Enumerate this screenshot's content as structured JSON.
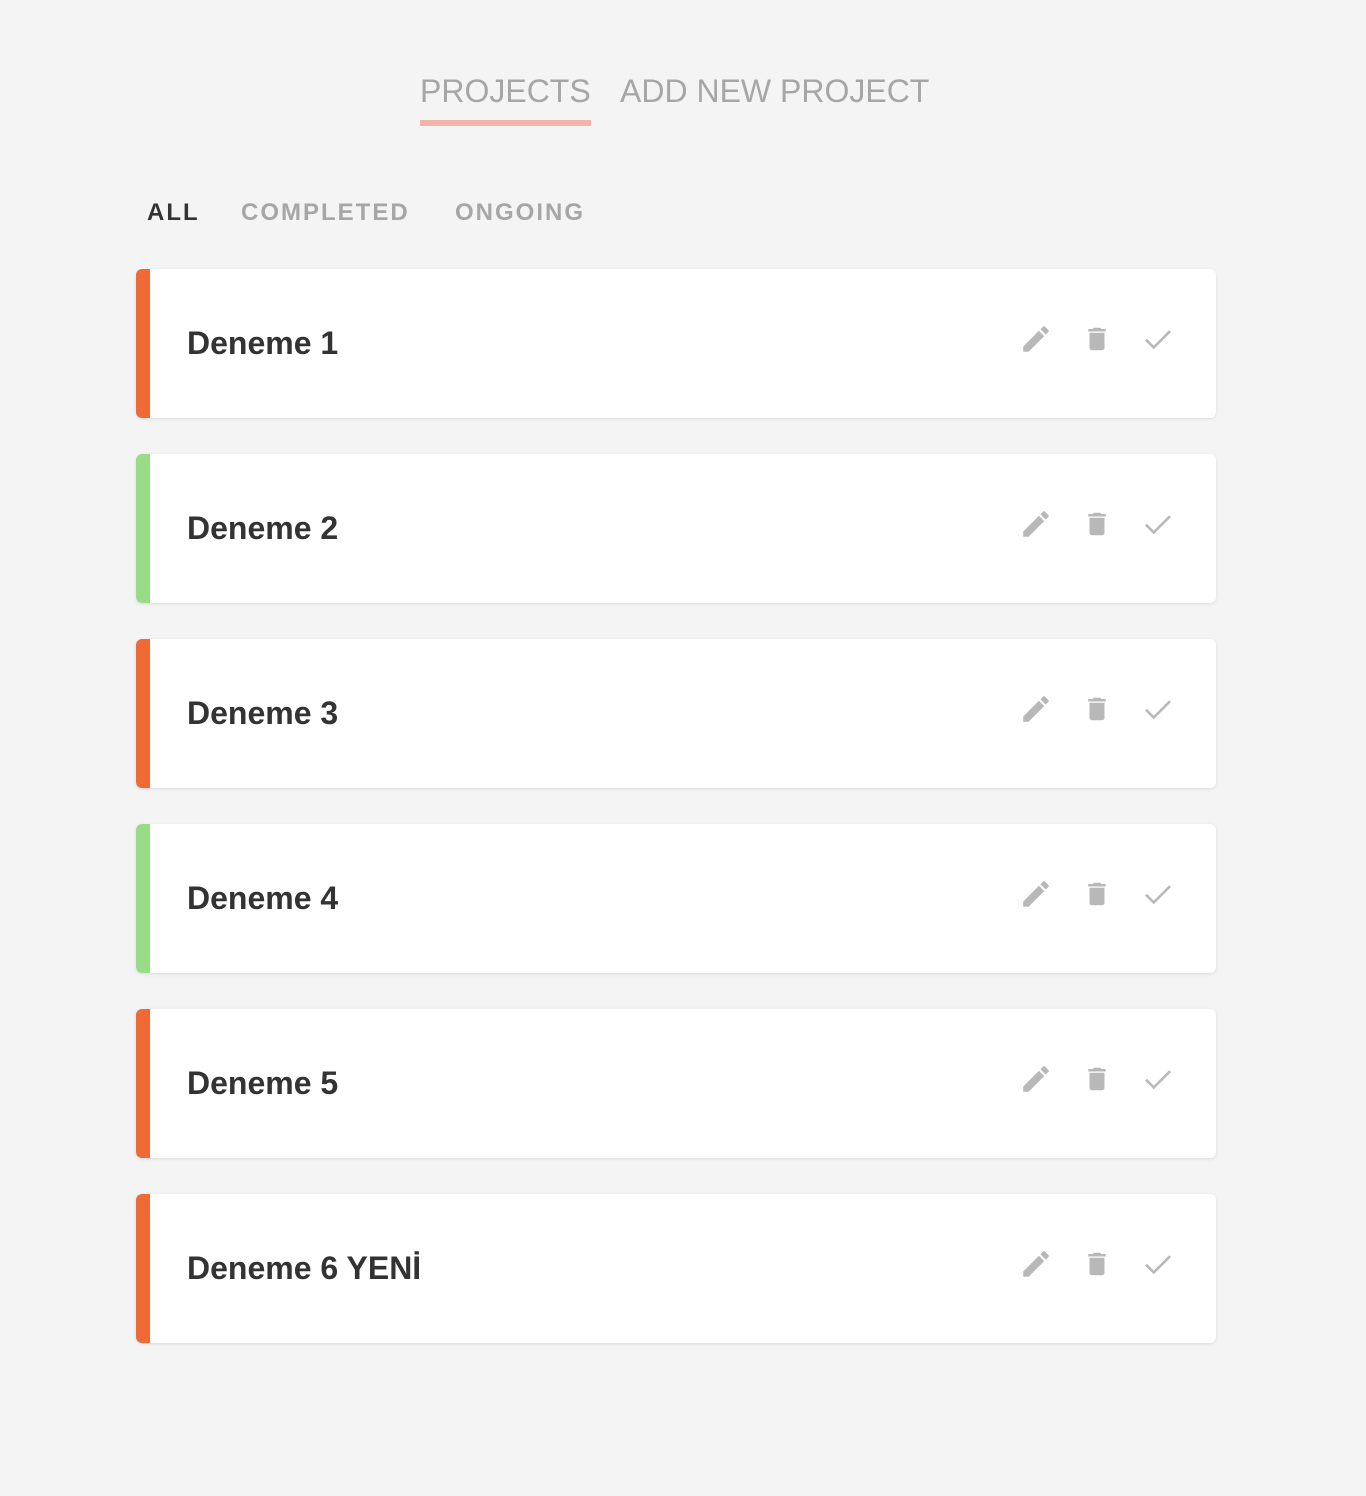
{
  "nav": {
    "tabs": [
      {
        "label": "PROJECTS",
        "active": true
      },
      {
        "label": "ADD NEW PROJECT",
        "active": false
      }
    ]
  },
  "filters": {
    "items": [
      {
        "label": "ALL",
        "active": true
      },
      {
        "label": "COMPLETED",
        "active": false
      },
      {
        "label": "ONGOING",
        "active": false
      }
    ]
  },
  "colors": {
    "ongoing": "#ef6a35",
    "completed": "#99dc86",
    "icon": "#b8b8b8",
    "active_tab_underline": "#f2b3ab"
  },
  "projects": [
    {
      "name": "Deneme 1",
      "status": "ongoing",
      "status_color": "#ef6a35"
    },
    {
      "name": "Deneme 2",
      "status": "completed",
      "status_color": "#99dc86"
    },
    {
      "name": "Deneme 3",
      "status": "ongoing",
      "status_color": "#ef6a35"
    },
    {
      "name": "Deneme 4",
      "status": "completed",
      "status_color": "#99dc86"
    },
    {
      "name": "Deneme 5",
      "status": "ongoing",
      "status_color": "#ef6a35"
    },
    {
      "name": "Deneme 6 YENİ",
      "status": "ongoing",
      "status_color": "#ef6a35"
    }
  ],
  "action_icons": [
    "pencil-icon",
    "trash-icon",
    "check-icon"
  ]
}
